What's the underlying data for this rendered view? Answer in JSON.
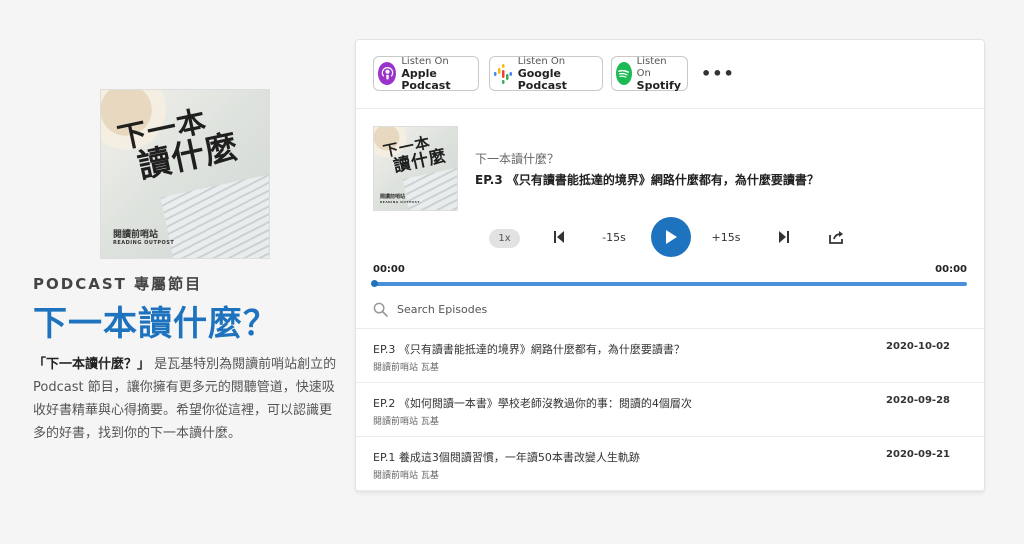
{
  "show": {
    "cover_title_line1": "下一本",
    "cover_title_line2": "讀什麼",
    "cover_logo": "閱讀前哨站",
    "cover_logo_sub": "READING OUTPOST",
    "kicker": "PODCAST 專屬節目",
    "title": "下一本讀什麼？",
    "description_bold": "「下一本讀什麼？」",
    "description_rest": "是瓦基特別為閱讀前哨站創立的 Podcast 節目，讓你擁有更多元的閱聽管道，快速吸收好書精華與心得摘要。希望你從這裡，可以認識更多的好書，找到你的下一本讀什麼。"
  },
  "listen_buttons": [
    {
      "small": "Listen On",
      "label": "Apple Podcast",
      "icon": "apple-podcast-icon",
      "color": "#9933cc"
    },
    {
      "small": "Listen On",
      "label": "Google Podcast",
      "icon": "google-podcast-icon",
      "color": "#4285f4"
    },
    {
      "small": "Listen On",
      "label": "Spotify",
      "icon": "spotify-icon",
      "color": "#1db954"
    }
  ],
  "more_label": "•••",
  "player": {
    "show_title": "下一本讀什麼？",
    "episode_title": "EP.3 《只有讀書能抵達的境界》網路什麼都有，為什麼要讀書？",
    "speed": "1x",
    "back_label": "-15s",
    "fwd_label": "+15s",
    "time_current": "00:00",
    "time_total": "00:00",
    "progress": 0,
    "accent": "#1e73be"
  },
  "search": {
    "placeholder": "Search Episodes"
  },
  "episodes": [
    {
      "title": "EP.3 《只有讀書能抵達的境界》網路什麼都有，為什麼要讀書？",
      "author": "閱讀前哨站 瓦基",
      "date": "2020-10-02"
    },
    {
      "title": "EP.2 《如何閱讀一本書》學校老師沒教過你的事：閱讀的4個層次",
      "author": "閱讀前哨站 瓦基",
      "date": "2020-09-28"
    },
    {
      "title": "EP.1 養成這3個閱讀習慣，一年讀50本書改變人生軌跡",
      "author": "閱讀前哨站 瓦基",
      "date": "2020-09-21"
    }
  ]
}
